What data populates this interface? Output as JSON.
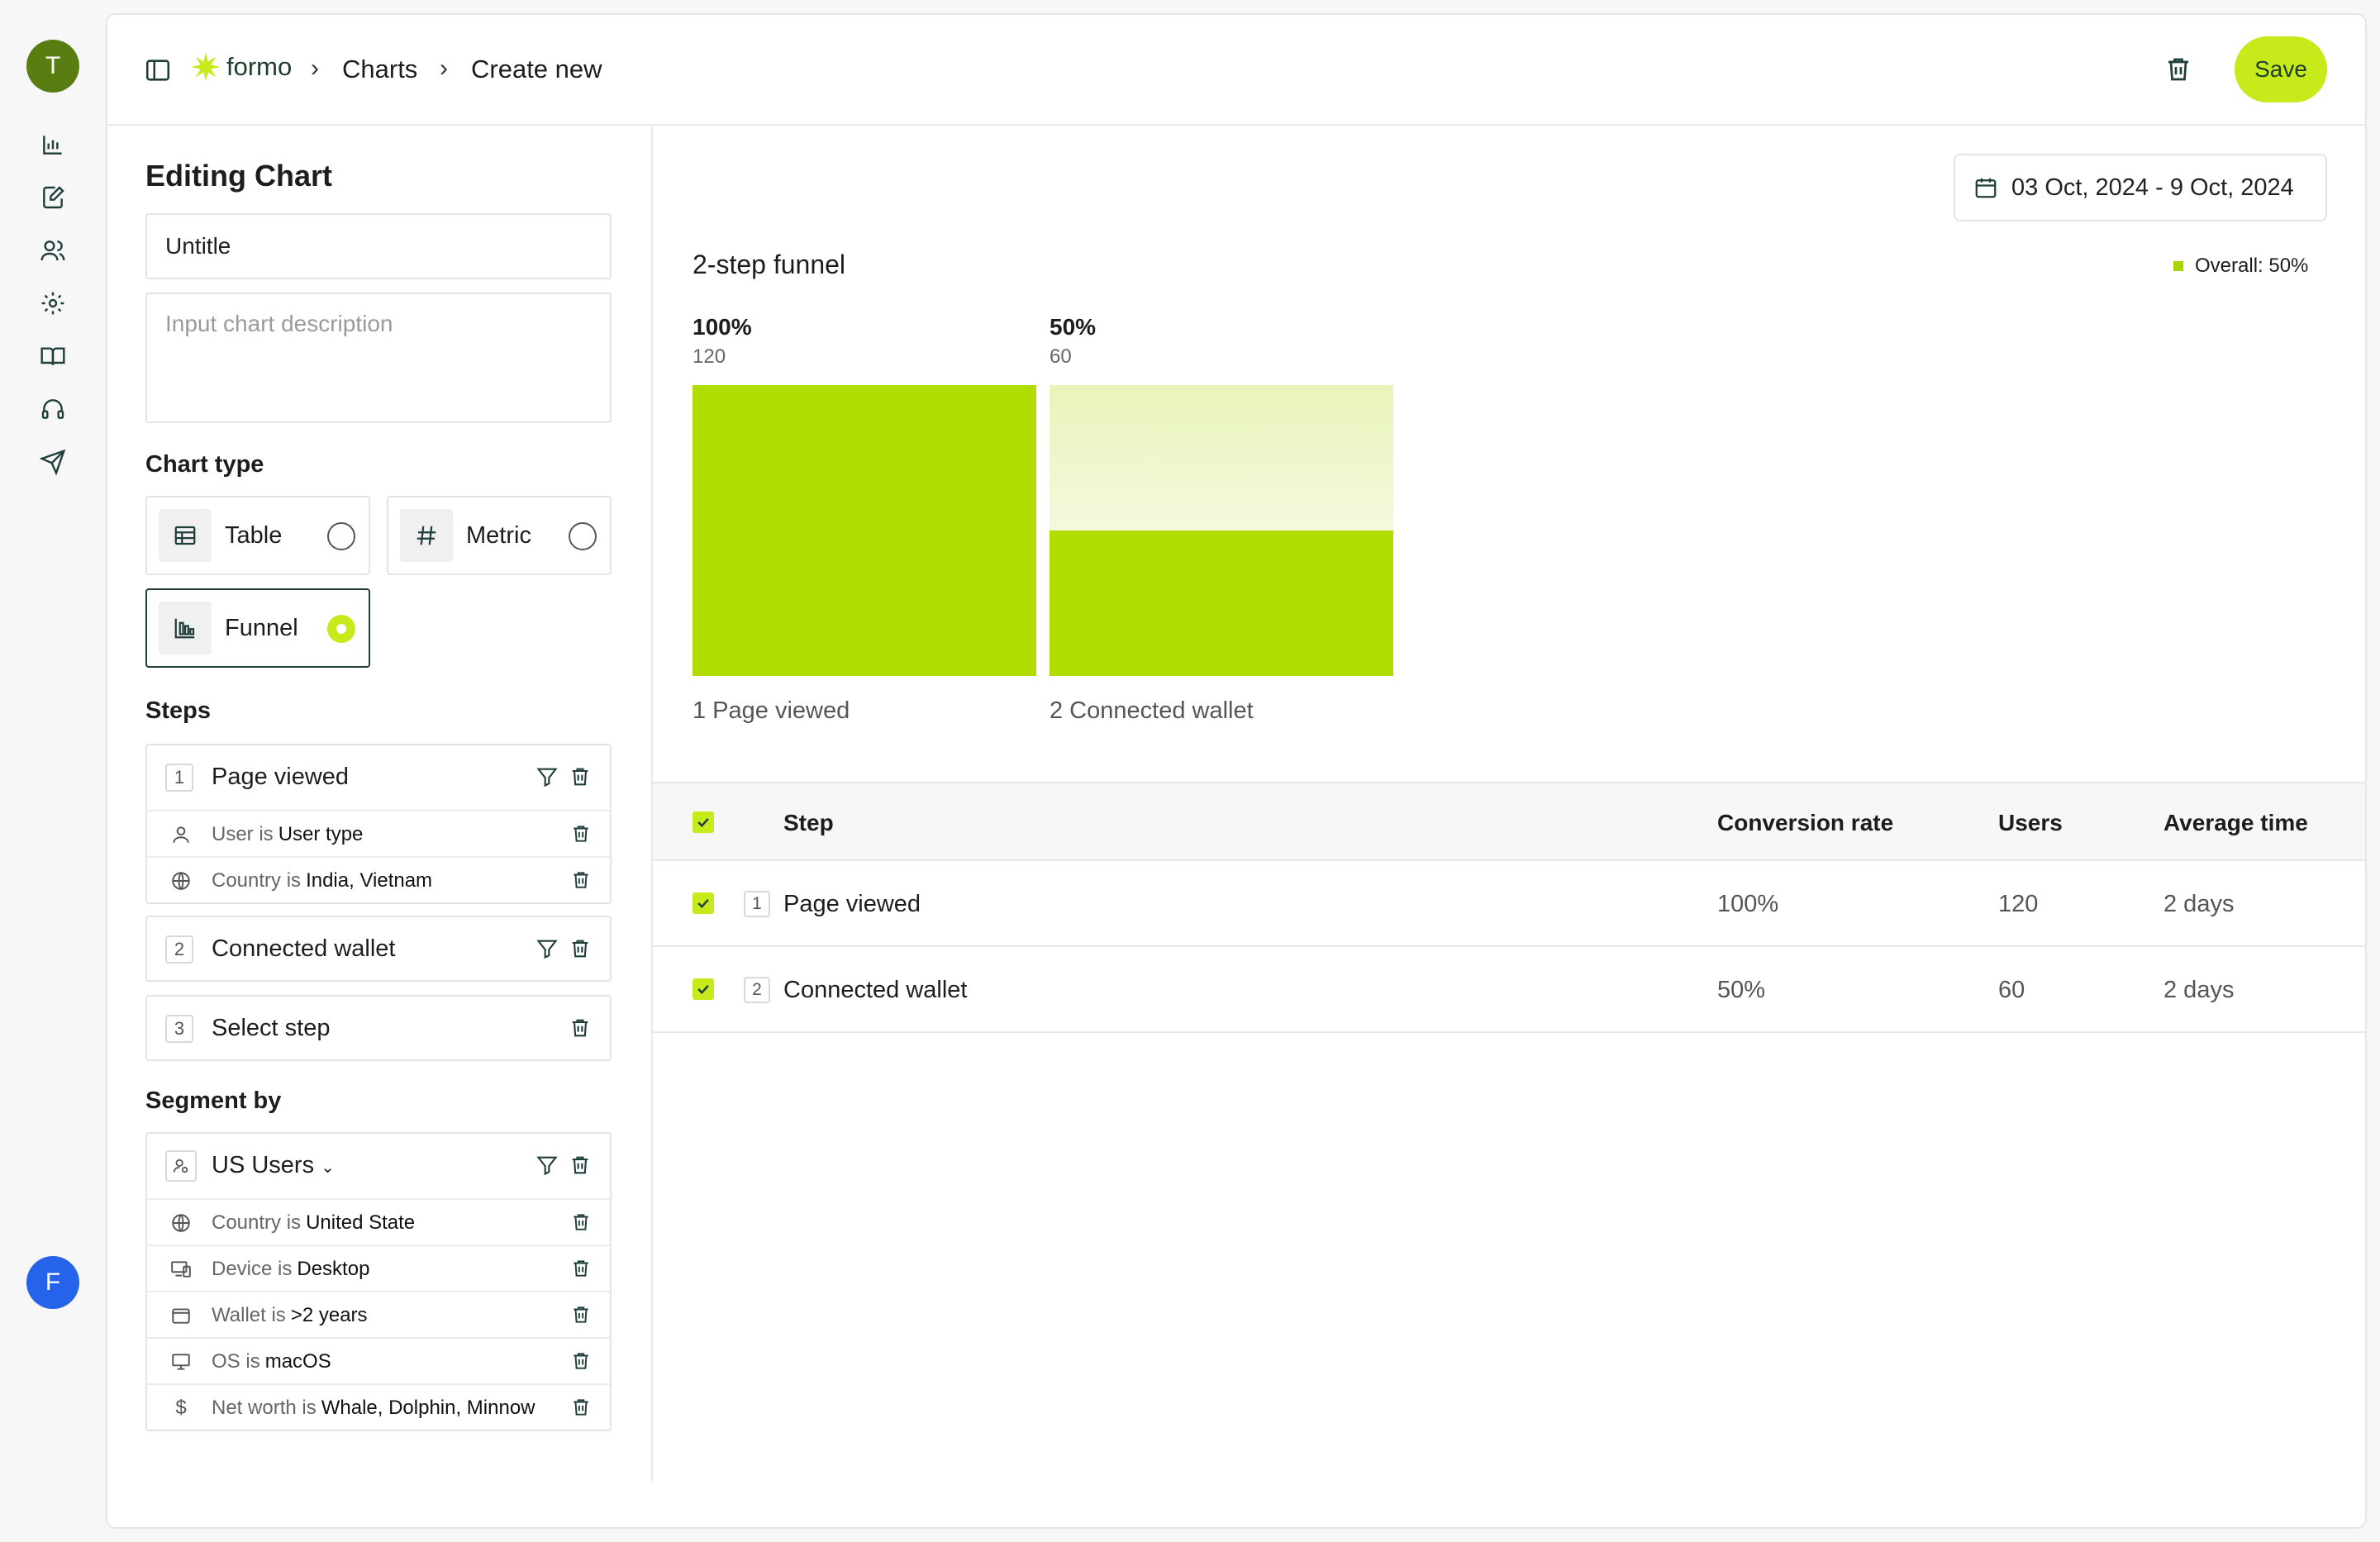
{
  "rail": {
    "top_avatar": "T",
    "bottom_avatar": "F",
    "icons": [
      "chart-icon",
      "edit-icon",
      "users-icon",
      "gear-icon",
      "book-icon",
      "headset-icon",
      "send-icon"
    ]
  },
  "header": {
    "brand": "formo",
    "breadcrumb": [
      "Charts",
      "Create new"
    ],
    "save_label": "Save"
  },
  "editor": {
    "heading": "Editing Chart",
    "title_value": "Untitle",
    "description_placeholder": "Input chart description",
    "chart_type_label": "Chart type",
    "chart_types": [
      {
        "label": "Table",
        "selected": false
      },
      {
        "label": "Metric",
        "selected": false
      },
      {
        "label": "Funnel",
        "selected": true
      }
    ],
    "steps_label": "Steps",
    "steps": [
      {
        "num": "1",
        "label": "Page viewed",
        "filters": [
          {
            "field": "User",
            "op": "is",
            "value": "User type",
            "icon": "user-icon"
          },
          {
            "field": "Country",
            "op": "is",
            "value": "India, Vietnam",
            "icon": "globe-icon"
          }
        ]
      },
      {
        "num": "2",
        "label": "Connected wallet",
        "filters": []
      },
      {
        "num": "3",
        "label": "Select step",
        "filters": []
      }
    ],
    "segment_label": "Segment by",
    "segment": {
      "name": "US Users",
      "filters": [
        {
          "field": "Country",
          "op": "is",
          "value": "United State",
          "icon": "globe-icon"
        },
        {
          "field": "Device",
          "op": "is",
          "value": "Desktop",
          "icon": "devices-icon"
        },
        {
          "field": "Wallet",
          "op": "is",
          "value": ">2 years",
          "icon": "wallet-icon"
        },
        {
          "field": "OS",
          "op": "is",
          "value": "macOS",
          "icon": "monitor-icon"
        },
        {
          "field": "Net worth",
          "op": "is",
          "value": "Whale, Dolphin, Minnow",
          "icon": "dollar-icon"
        }
      ]
    }
  },
  "report": {
    "date_range": "03 Oct, 2024 - 9 Oct, 2024",
    "overall": "Overall: 50%"
  },
  "chart_data": {
    "type": "bar",
    "title": "2-step funnel",
    "categories": [
      "1 Page viewed",
      "2 Connected wallet"
    ],
    "percent_labels": [
      "100%",
      "50%"
    ],
    "count_labels": [
      "120",
      "60"
    ],
    "values": [
      100,
      50
    ],
    "counts": [
      120,
      60
    ],
    "ylim": [
      0,
      100
    ],
    "colors": {
      "bar": "#b1dd00",
      "dropoff_top": "#e8f4bb",
      "dropoff_bottom": "#f3f9dd"
    }
  },
  "table": {
    "headers": {
      "step": "Step",
      "conversion": "Conversion rate",
      "users": "Users",
      "avg_time": "Average time"
    },
    "rows": [
      {
        "num": "1",
        "step": "Page viewed",
        "conversion": "100%",
        "users": "120",
        "avg_time": "2 days"
      },
      {
        "num": "2",
        "step": "Connected wallet",
        "conversion": "50%",
        "users": "60",
        "avg_time": "2 days"
      }
    ]
  },
  "colors": {
    "accent": "#c7ea1b",
    "brand_dark": "#1f3d2a",
    "avatar_top": "#5a7d12",
    "avatar_bottom": "#2563eb"
  }
}
